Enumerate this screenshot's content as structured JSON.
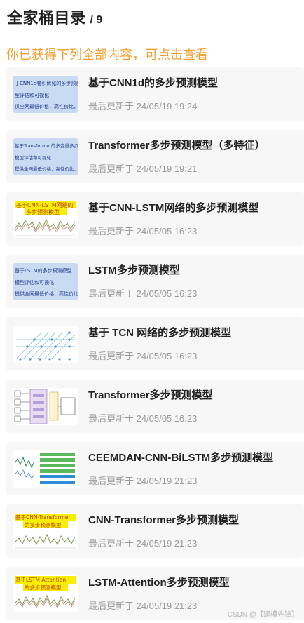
{
  "header": {
    "title": "全家桶目录",
    "count": "/ 9"
  },
  "subtitle": "你已获得下列全部内容，可点击查看",
  "update_prefix": "最后更新于",
  "items": [
    {
      "title": "基于CNN1d的多步预测模型",
      "updated": "最后更新于 24/05/19 19:24",
      "thumb_icon": "text-doc-thumbnail",
      "thumb_lines": [
        "于CNN1d卷积优化的多步预测",
        "型评估和可视化",
        "供全网最低价格，高性价比，超"
      ]
    },
    {
      "title": "Transformer多步预测模型（多特征）",
      "updated": "最后更新于 24/05/19 19:21",
      "thumb_icon": "text-doc-thumbnail",
      "thumb_lines": [
        "基于Transformer的多变量多步预",
        "模型评估和可视化",
        "提供全网最低价格，高性价比，超"
      ]
    },
    {
      "title": "基于CNN-LSTM网络的多步预测模型",
      "updated": "最后更新于 24/05/05 16:23",
      "thumb_icon": "chart-thumbnail",
      "thumb_lines": [
        "基于CNN-LSTM网络的",
        "多步预测模型"
      ]
    },
    {
      "title": "LSTM多步预测模型",
      "updated": "最后更新于 24/05/05 16:23",
      "thumb_icon": "text-doc-thumbnail",
      "thumb_lines": [
        "基于LSTM的多步预测模型",
        "模型评估和可视化",
        "提供全网最低价格，高性价比，"
      ]
    },
    {
      "title": "基于 TCN 网络的多步预测模型",
      "updated": "最后更新于 24/05/05 16:23",
      "thumb_icon": "network-diagram-thumbnail",
      "thumb_lines": []
    },
    {
      "title": "Transformer多步预测模型",
      "updated": "最后更新于 24/05/05 16:23",
      "thumb_icon": "architecture-diagram-thumbnail",
      "thumb_lines": []
    },
    {
      "title": "CEEMDAN-CNN-BiLSTM多步预测模型",
      "updated": "最后更新于 24/05/19 21:23",
      "thumb_icon": "signal-plots-thumbnail",
      "thumb_lines": []
    },
    {
      "title": "CNN-Transformer多步预测模型",
      "updated": "最后更新于 24/05/19 21:23",
      "thumb_icon": "chart-thumbnail",
      "thumb_lines": [
        "基于CNN-Transformer",
        "的多步预测模型"
      ]
    },
    {
      "title": "LSTM-Attention多步预测模型",
      "updated": "最后更新于 24/05/19 21:23",
      "thumb_icon": "chart-thumbnail",
      "thumb_lines": [
        "基于LSTM-Attention",
        "的多步预测模型"
      ]
    }
  ],
  "footer": "CSDN @【建模先锋】",
  "colors": {
    "accent": "#f2a233",
    "card_bg": "#f7f7f7",
    "meta": "#9a9a9a",
    "thumb_blue": "#c9daf3",
    "thumb_yellow": "#f6f000"
  }
}
